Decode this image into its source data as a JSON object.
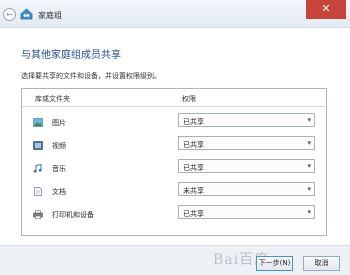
{
  "window": {
    "title": "家庭组",
    "close_glyph": "✕"
  },
  "nav": {
    "back_glyph": "←"
  },
  "page": {
    "heading": "与其他家庭组成员共享",
    "subtitle": "选择要共享的文件和设备，并设置权限级别。"
  },
  "table": {
    "col_folder": "库或文件夹",
    "col_permission": "权限",
    "rows": [
      {
        "label": "图片",
        "permission": "已共享",
        "icon": "pictures-icon"
      },
      {
        "label": "视频",
        "permission": "已共享",
        "icon": "videos-icon"
      },
      {
        "label": "音乐",
        "permission": "已共享",
        "icon": "music-icon"
      },
      {
        "label": "文档",
        "permission": "未共享",
        "icon": "documents-icon"
      },
      {
        "label": "打印机和设备",
        "permission": "已共享",
        "icon": "printer-icon"
      }
    ]
  },
  "footer": {
    "next_label": "下一步(N)",
    "cancel_label": "取消",
    "watermark": "Bai百度"
  },
  "colors": {
    "accent": "#1f4a8c",
    "close": "#c7443b"
  }
}
